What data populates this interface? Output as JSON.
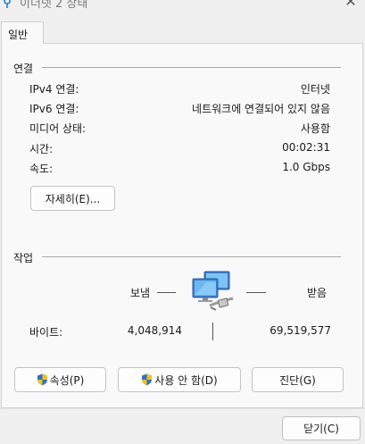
{
  "window": {
    "title": "이더넷 2 상태",
    "close_glyph": "✕"
  },
  "tabs": [
    {
      "label": "일반"
    }
  ],
  "connection": {
    "section_title": "연결",
    "rows": [
      {
        "label": "IPv4 연결:",
        "value": "인터넷"
      },
      {
        "label": "IPv6 연결:",
        "value": "네트워크에 연결되어 있지 않음"
      },
      {
        "label": "미디어 상태:",
        "value": "사용함"
      },
      {
        "label": "시간:",
        "value": "00:02:31"
      },
      {
        "label": "속도:",
        "value": "1.0 Gbps"
      }
    ],
    "details_button": "자세히(E)..."
  },
  "activity": {
    "section_title": "작업",
    "sent_label": "보냄",
    "received_label": "받음",
    "bytes_label": "바이트:",
    "bytes_sent": "4,048,914",
    "bytes_received": "69,519,577",
    "icon": "network-computers-icon"
  },
  "buttons": {
    "properties": "속성(P)",
    "disable": "사용 안 함(D)",
    "diagnose": "진단(G)",
    "close": "닫기(C)"
  },
  "colors": {
    "accent": "#0067c0",
    "shield_blue": "#2b6fd6",
    "shield_yellow": "#f5c400"
  }
}
